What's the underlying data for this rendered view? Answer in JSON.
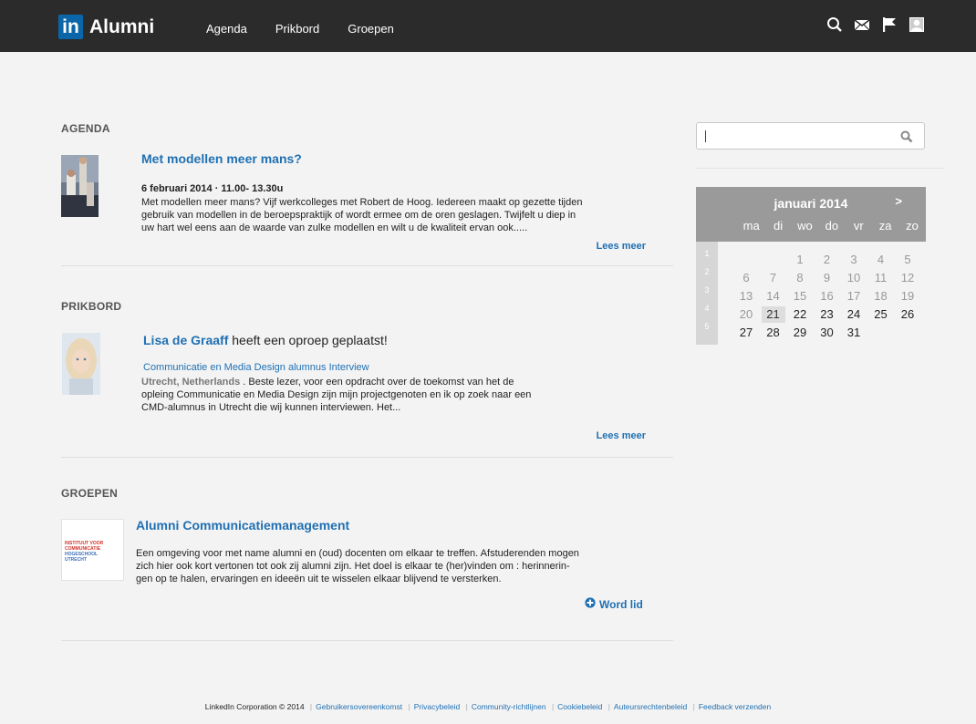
{
  "header": {
    "logo_mark": "in",
    "logo_text": "Alumni",
    "nav": [
      "Agenda",
      "Prikbord",
      "Groepen"
    ]
  },
  "agenda": {
    "section_title": "AGENDA",
    "item_title": "Met modellen meer mans?",
    "date": "6 februari 2014 · 11.00- 13.30u",
    "body_lines": [
      "Met modellen meer mans? Vijf werkcolleges met Robert de Hoog. Iedereen maakt op gezette tijden",
      "gebruik van modellen in de beroepspraktijk of wordt ermee om de oren geslagen. Twijfelt u diep in",
      "uw hart wel eens aan de waarde van zulke modellen en wilt u de kwaliteit ervan ook....."
    ],
    "read_more": "Lees meer"
  },
  "prikbord": {
    "section_title": "PRIKBORD",
    "author": "Lisa de Graaff",
    "action": " heeft een oproep geplaatst!",
    "subject": "Communicatie en Media Design alumnus Interview",
    "location": "Utrecht, Netherlands",
    "dot": " .  ",
    "body_first": "Beste lezer, voor een opdracht over de toekomst van het de",
    "body_lines": [
      "opleing Communicatie en Media Design zijn mijn projectgenoten en ik op zoek naar een",
      "CMD-alumnus in Utrecht die wij kunnen interviewen. Het..."
    ],
    "read_more": "Lees meer"
  },
  "groepen": {
    "section_title": "GROEPEN",
    "item_title": "Alumni Communicatiemanagement",
    "logo_lines": [
      "INSTITUUT VOOR",
      "COMMUNICATIE",
      "HOGESCHOOL",
      "UTRECHT"
    ],
    "body_lines": [
      "Een omgeving voor met name alumni en (oud) docenten om elkaar te treffen. Afstuderenden mogen",
      "zich hier ook kort vertonen tot ook zij alumni zijn. Het doel is elkaar te (her)vinden om : herinnerin-",
      "gen op te halen, ervaringen en ideeën uit te wisselen elkaar blijvend te versterken."
    ],
    "join": "Word lid"
  },
  "calendar": {
    "month": "januari 2014",
    "next": ">",
    "weekdays": [
      "ma",
      "di",
      "wo",
      "do",
      "vr",
      "za",
      "zo"
    ],
    "weeks": [
      "1",
      "2",
      "3",
      "4",
      "5"
    ],
    "rows": [
      [
        "",
        "",
        "1",
        "2",
        "3",
        "4",
        "5"
      ],
      [
        "6",
        "7",
        "8",
        "9",
        "10",
        "11",
        "12"
      ],
      [
        "13",
        "14",
        "15",
        "16",
        "17",
        "18",
        "19"
      ],
      [
        "20",
        "21",
        "22",
        "23",
        "24",
        "25",
        "26"
      ],
      [
        "27",
        "28",
        "29",
        "30",
        "31",
        "",
        ""
      ]
    ],
    "today": "21"
  },
  "footer": {
    "company": "LinkedIn Corporation © 2014",
    "links": [
      "Gebruikersovereenkomst",
      "Privacybeleid",
      "Community-richtlijnen",
      "Cookiebeleid",
      "Auteursrechtenbeleid",
      "Feedback verzenden"
    ]
  },
  "colors": {
    "accent": "#1f70b3",
    "header_bg": "#2b2b2b",
    "page_bg": "#f3f3f3"
  }
}
